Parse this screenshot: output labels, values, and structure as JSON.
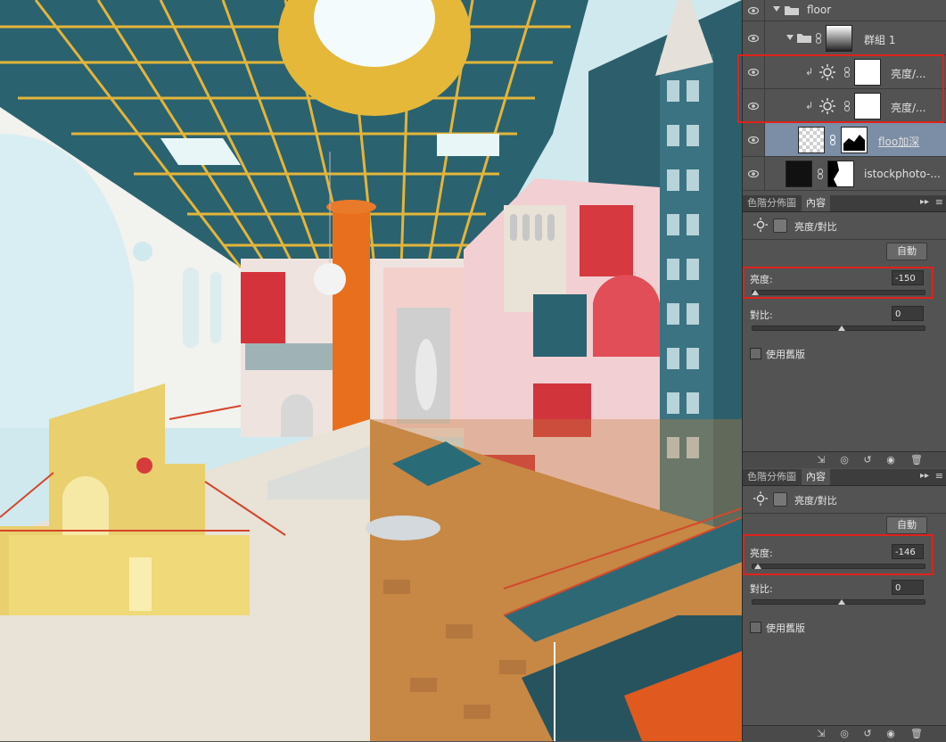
{
  "layers_panel": {
    "rows": [
      {
        "name": "floor"
      },
      {
        "name": "群組 1"
      },
      {
        "name": "亮度/..."
      },
      {
        "name": "亮度/..."
      },
      {
        "name": "floo加深"
      },
      {
        "name": "istockphoto-..."
      }
    ]
  },
  "properties_panels": [
    {
      "tabs": [
        "色階分佈圖",
        "內容"
      ],
      "title": "亮度/對比",
      "auto_label": "自動",
      "brightness_label": "亮度:",
      "brightness_value": "-150",
      "brightness_fraction": 0.0,
      "contrast_label": "對比:",
      "contrast_value": "0",
      "contrast_fraction": 0.5,
      "legacy_label": "使用舊版"
    },
    {
      "tabs": [
        "色階分佈圖",
        "內容"
      ],
      "title": "亮度/對比",
      "auto_label": "自動",
      "brightness_label": "亮度:",
      "brightness_value": "-146",
      "brightness_fraction": 0.013,
      "contrast_label": "對比:",
      "contrast_value": "0",
      "contrast_fraction": 0.5,
      "legacy_label": "使用舊版"
    }
  ],
  "icons": [
    "eye-icon",
    "folder-icon",
    "link-icon",
    "adjustment-icon",
    "clip-arrow-icon",
    "trash-icon",
    "reset-icon",
    "visibility-icon"
  ],
  "colors": {
    "highlight": "#e0221b",
    "panel_bg": "#535353",
    "selected_row": "#7b8ea6"
  }
}
